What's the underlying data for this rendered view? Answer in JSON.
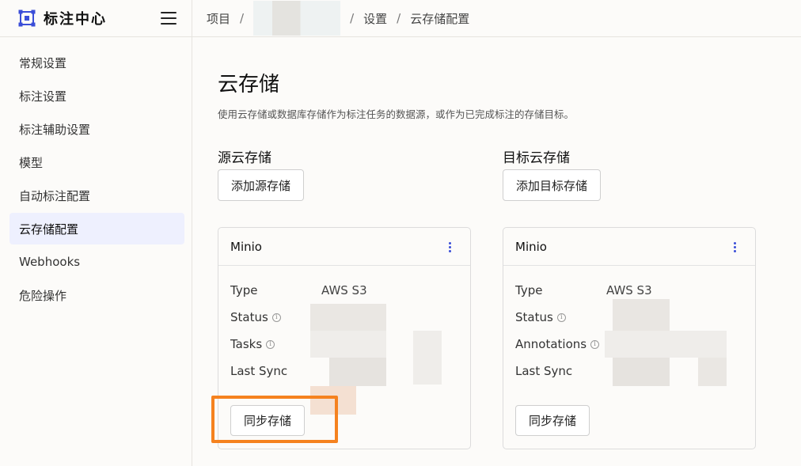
{
  "brand": {
    "title": "标注中心"
  },
  "sidebar": {
    "items": [
      {
        "label": "常规设置"
      },
      {
        "label": "标注设置"
      },
      {
        "label": "标注辅助设置"
      },
      {
        "label": "模型"
      },
      {
        "label": "自动标注配置"
      },
      {
        "label": "云存储配置"
      },
      {
        "label": "Webhooks"
      },
      {
        "label": "危险操作"
      }
    ],
    "active_index": 5
  },
  "breadcrumb": {
    "items": [
      "项目",
      "设置",
      "云存储配置"
    ]
  },
  "page": {
    "title": "云存储",
    "description": "使用云存储或数据库存储作为标注任务的数据源，或作为已完成标注的存储目标。"
  },
  "source": {
    "title": "源云存储",
    "add_label": "添加源存储",
    "card": {
      "name": "Minio",
      "rows": [
        {
          "key": "Type",
          "value": "AWS S3"
        },
        {
          "key": "Status",
          "value": ""
        },
        {
          "key": "Tasks",
          "value": ""
        },
        {
          "key": "Last Sync",
          "value": ""
        }
      ],
      "sync_label": "同步存储"
    }
  },
  "target": {
    "title": "目标云存储",
    "add_label": "添加目标存储",
    "card": {
      "name": "Minio",
      "rows": [
        {
          "key": "Type",
          "value": "AWS S3"
        },
        {
          "key": "Status",
          "value": ""
        },
        {
          "key": "Annotations",
          "value": ""
        },
        {
          "key": "Last Sync",
          "value": ""
        }
      ],
      "sync_label": "同步存储"
    }
  },
  "colors": {
    "accent": "#3b4ed8",
    "highlight": "#f5821f",
    "active_bg": "#eef0fe"
  },
  "icons": {
    "info": "info-icon",
    "menu": "hamburger-menu-icon",
    "logo": "logo-icon",
    "more": "more-vertical-icon"
  },
  "info_glyph": "i"
}
